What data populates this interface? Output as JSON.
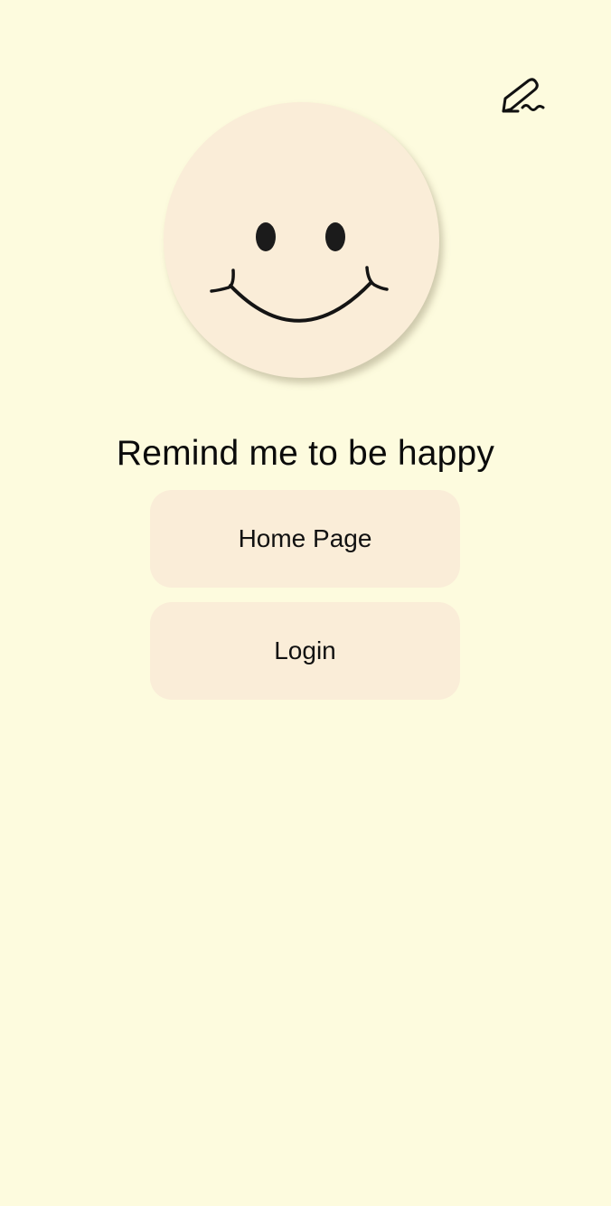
{
  "colors": {
    "background": "#FDFBDE",
    "card": "#FAEDD8",
    "text": "#111111"
  },
  "header": {
    "edit_icon": "signature-pen-icon"
  },
  "hero": {
    "icon": "smiley-face-icon",
    "title": "Remind me to be happy"
  },
  "actions": {
    "home_label": "Home Page",
    "login_label": "Login"
  }
}
